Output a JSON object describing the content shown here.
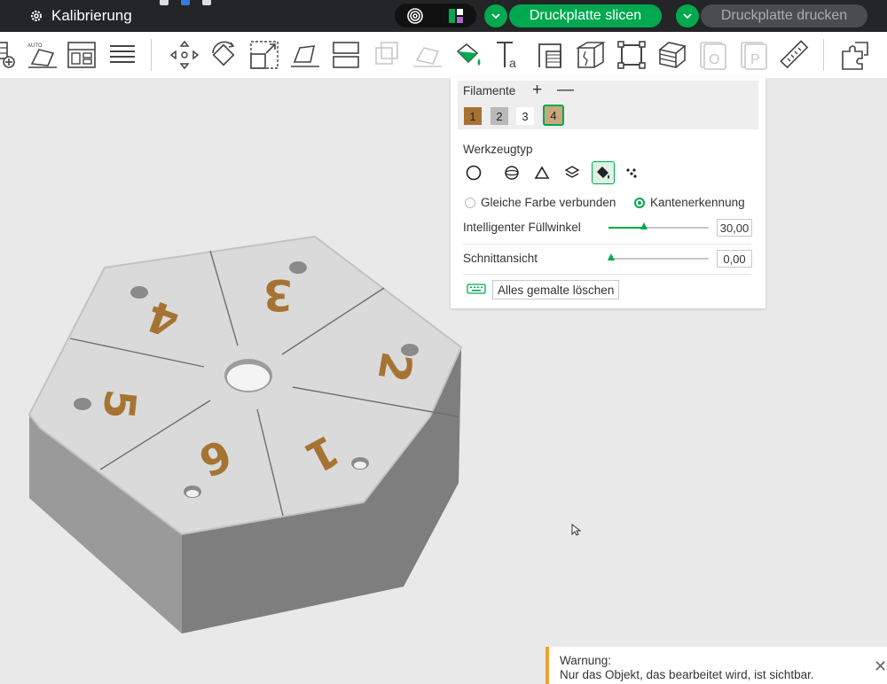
{
  "topbar": {
    "project_title": "Kalibrierung",
    "slice_label": "Druckplatte slicen",
    "print_label": "Druckplatte drucken"
  },
  "toolbar": {
    "tools": [
      "add-plate-icon",
      "auto-orient-icon",
      "arrange-icon",
      "layers-icon",
      "move-icon",
      "rotate-icon",
      "scale-icon",
      "lay-on-face-icon",
      "split-icon",
      "boolean-icon",
      "support-paint-icon",
      "color-paint-icon",
      "text-icon",
      "seam-icon",
      "cut-icon",
      "measure-box-icon",
      "variable-layer-icon",
      "assembly-icon",
      "plate-o-icon",
      "plate-p-icon",
      "ruler-icon",
      "part-assembly-icon"
    ],
    "auto_label": "AUTO"
  },
  "panel": {
    "filaments_title": "Filamente",
    "plus": "+",
    "minus": "—",
    "swatches": [
      {
        "label": "1",
        "color": "#a67232"
      },
      {
        "label": "2",
        "color": "#b9b9b9"
      },
      {
        "label": "3",
        "color": "#ffffff"
      },
      {
        "label": "4",
        "color": "#c8a879"
      }
    ],
    "selected_filament": "4",
    "tooltype_title": "Werkzeugtyp",
    "tooltypes": [
      "circle-icon",
      "sphere-icon",
      "triangle-icon",
      "layers-icon",
      "fill-bucket-icon",
      "gap-fill-icon"
    ],
    "active_tool": "fill-bucket-icon",
    "radio_same_color": "Gleiche Farbe verbunden",
    "radio_edge": "Kantenerkennung",
    "radio_selected": "Kantenerkennung",
    "smart_fill_label": "Intelligenter Füllwinkel",
    "smart_fill_value": "30,00",
    "smart_fill_fraction": 0.35,
    "section_label": "Schnittansicht",
    "section_value": "0,00",
    "section_fraction": 0.03,
    "erase_all_label": "Alles gemalte löschen"
  },
  "model": {
    "face_numbers": [
      "1",
      "2",
      "3",
      "4",
      "5",
      "6"
    ],
    "number_color": "#a57433"
  },
  "warning": {
    "title": "Warnung:",
    "message": "Nur das Objekt, das bearbeitet wird, ist sichtbar."
  },
  "colors": {
    "accent": "#00a84f",
    "topbar": "#232526",
    "warning": "#f0a030"
  }
}
